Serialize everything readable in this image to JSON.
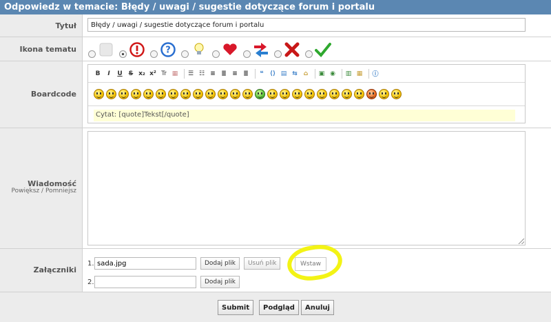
{
  "header": {
    "title": "Odpowiedz w temacie: Błędy / uwagi / sugestie dotyczące forum i portalu"
  },
  "title_row": {
    "label": "Tytuł",
    "value": "Błędy / uwagi / sugestie dotyczące forum i portalu"
  },
  "icon_row": {
    "label": "Ikona tematu",
    "icons": [
      "blank-icon",
      "exclamation-icon",
      "question-icon",
      "lightbulb-icon",
      "heart-icon",
      "arrows-icon",
      "red-x-icon",
      "checkmark-icon"
    ],
    "selected_index": 0
  },
  "boardcode": {
    "label": "Boardcode",
    "toolbar": [
      "B",
      "I",
      "U",
      "S",
      "x₂",
      "x²",
      "Tr",
      "▦",
      "list",
      "olist",
      "ulist",
      "align-left",
      "align-center",
      "align-right",
      "quote",
      "code",
      "table",
      "swap",
      "image",
      "link",
      "flash",
      "calendar",
      "help"
    ],
    "smiley_count": 24,
    "hint": "Cytat: [quote]Tekst[/quote]"
  },
  "message": {
    "label": "Wiadomość",
    "zoom_in": "Powiększ",
    "zoom_sep": "/",
    "zoom_out": "Pomniejsz",
    "value": ""
  },
  "attachments": {
    "label": "Załączniki",
    "rows": [
      {
        "num": "1.",
        "value": "sada.jpg",
        "add": "Dodaj plik",
        "remove": "Usuń plik",
        "insert": "Wstaw"
      },
      {
        "num": "2.",
        "value": "",
        "add": "Dodaj plik"
      }
    ],
    "highlight_color": "#f3f315"
  },
  "footer": {
    "submit": "Submit",
    "preview": "Podgląd",
    "cancel": "Anuluj"
  },
  "colors": {
    "header_bg": "#5b87b2",
    "label_bg": "#ececec"
  }
}
